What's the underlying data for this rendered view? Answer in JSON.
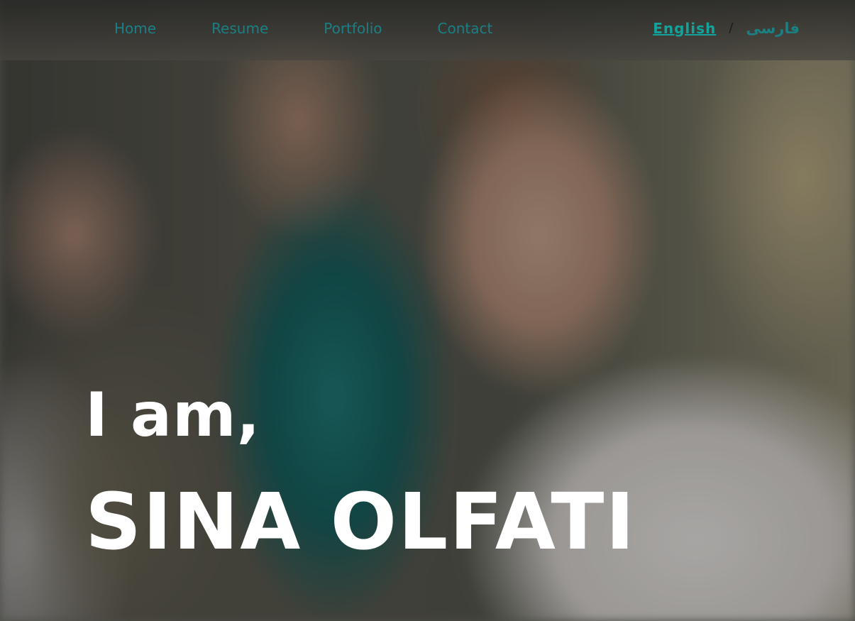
{
  "nav": {
    "items": [
      {
        "label": "Home"
      },
      {
        "label": "Resume"
      },
      {
        "label": "Portfolio"
      },
      {
        "label": "Contact"
      }
    ],
    "language": {
      "english": "English",
      "separator": "/",
      "persian": "فارسی"
    }
  },
  "hero": {
    "intro": "I am,",
    "name": "SINA OLFATI"
  },
  "colors": {
    "nav_link": "#1b7f86",
    "active_language": "#12a49c",
    "heading": "#ffffff"
  }
}
